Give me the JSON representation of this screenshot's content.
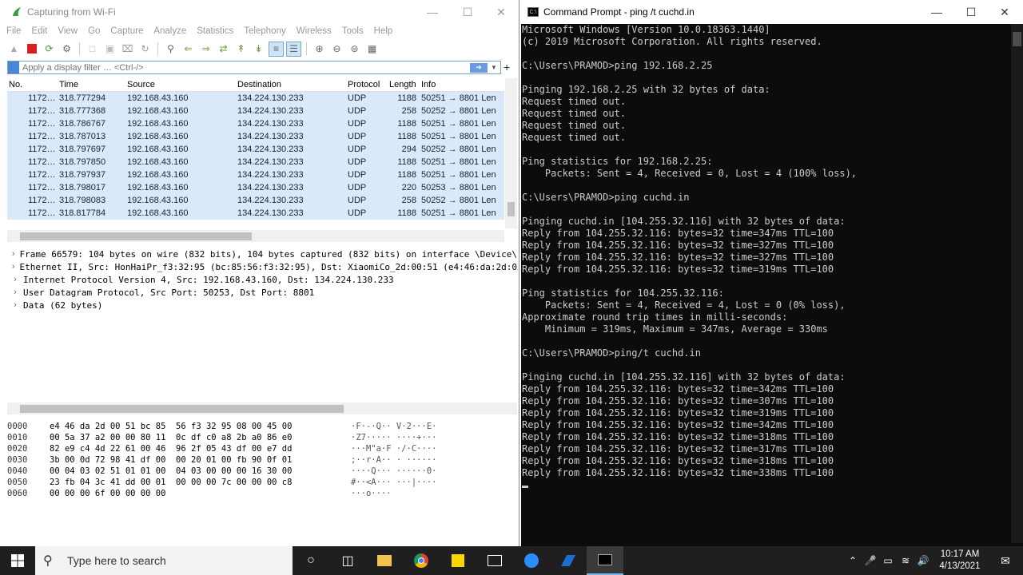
{
  "wireshark": {
    "title": "Capturing from Wi-Fi",
    "menu": [
      "File",
      "Edit",
      "View",
      "Go",
      "Capture",
      "Analyze",
      "Statistics",
      "Telephony",
      "Wireless",
      "Tools",
      "Help"
    ],
    "filter_placeholder": "Apply a display filter … <Ctrl-/>",
    "columns": [
      "No.",
      "Time",
      "Source",
      "Destination",
      "Protocol",
      "Length",
      "Info"
    ],
    "packets": [
      {
        "no": "1172…",
        "time": "318.777294",
        "src": "192.168.43.160",
        "dst": "134.224.130.233",
        "proto": "UDP",
        "len": "1188",
        "info": "50251 → 8801 Len"
      },
      {
        "no": "1172…",
        "time": "318.777368",
        "src": "192.168.43.160",
        "dst": "134.224.130.233",
        "proto": "UDP",
        "len": "258",
        "info": "50252 → 8801 Len"
      },
      {
        "no": "1172…",
        "time": "318.786767",
        "src": "192.168.43.160",
        "dst": "134.224.130.233",
        "proto": "UDP",
        "len": "1188",
        "info": "50251 → 8801 Len"
      },
      {
        "no": "1172…",
        "time": "318.787013",
        "src": "192.168.43.160",
        "dst": "134.224.130.233",
        "proto": "UDP",
        "len": "1188",
        "info": "50251 → 8801 Len"
      },
      {
        "no": "1172…",
        "time": "318.797697",
        "src": "192.168.43.160",
        "dst": "134.224.130.233",
        "proto": "UDP",
        "len": "294",
        "info": "50252 → 8801 Len"
      },
      {
        "no": "1172…",
        "time": "318.797850",
        "src": "192.168.43.160",
        "dst": "134.224.130.233",
        "proto": "UDP",
        "len": "1188",
        "info": "50251 → 8801 Len"
      },
      {
        "no": "1172…",
        "time": "318.797937",
        "src": "192.168.43.160",
        "dst": "134.224.130.233",
        "proto": "UDP",
        "len": "1188",
        "info": "50251 → 8801 Len"
      },
      {
        "no": "1172…",
        "time": "318.798017",
        "src": "192.168.43.160",
        "dst": "134.224.130.233",
        "proto": "UDP",
        "len": "220",
        "info": "50253 → 8801 Len"
      },
      {
        "no": "1172…",
        "time": "318.798083",
        "src": "192.168.43.160",
        "dst": "134.224.130.233",
        "proto": "UDP",
        "len": "258",
        "info": "50252 → 8801 Len"
      },
      {
        "no": "1172…",
        "time": "318.817784",
        "src": "192.168.43.160",
        "dst": "134.224.130.233",
        "proto": "UDP",
        "len": "1188",
        "info": "50251 → 8801 Len"
      }
    ],
    "details": [
      "Frame 66579: 104 bytes on wire (832 bits), 104 bytes captured (832 bits) on interface \\Device\\",
      "Ethernet II, Src: HonHaiPr_f3:32:95 (bc:85:56:f3:32:95), Dst: XiaomiCo_2d:00:51 (e4:46:da:2d:0",
      "Internet Protocol Version 4, Src: 192.168.43.160, Dst: 134.224.130.233",
      "User Datagram Protocol, Src Port: 50253, Dst Port: 8801",
      "Data (62 bytes)"
    ],
    "hex": [
      {
        "off": "0000",
        "bytes": "e4 46 da 2d 00 51 bc 85  56 f3 32 95 08 00 45 00",
        "ascii": "·F·-·Q·· V·2···E·"
      },
      {
        "off": "0010",
        "bytes": "00 5a 37 a2 00 00 80 11  0c df c0 a8 2b a0 86 e0",
        "ascii": "·Z7····· ····+···"
      },
      {
        "off": "0020",
        "bytes": "82 e9 c4 4d 22 61 00 46  96 2f 05 43 df 00 e7 dd",
        "ascii": "···M\"a·F ·/·C····"
      },
      {
        "off": "0030",
        "bytes": "3b 00 0d 72 98 41 df 00  00 20 01 00 fb 90 0f 01",
        "ascii": ";··r·A·· · ······"
      },
      {
        "off": "0040",
        "bytes": "00 04 03 02 51 01 01 00  04 03 00 00 00 16 30 00",
        "ascii": "····Q··· ······0·"
      },
      {
        "off": "0050",
        "bytes": "23 fb 04 3c 41 dd 00 01  00 00 00 7c 00 00 00 c8",
        "ascii": "#··<A··· ···|····"
      },
      {
        "off": "0060",
        "bytes": "00 00 00 6f 00 00 00 00",
        "ascii": "···o····"
      }
    ]
  },
  "cmd": {
    "title": "Command Prompt - ping /t cuchd.in",
    "lines": [
      "Microsoft Windows [Version 10.0.18363.1440]",
      "(c) 2019 Microsoft Corporation. All rights reserved.",
      "",
      "C:\\Users\\PRAMOD>ping 192.168.2.25",
      "",
      "Pinging 192.168.2.25 with 32 bytes of data:",
      "Request timed out.",
      "Request timed out.",
      "Request timed out.",
      "Request timed out.",
      "",
      "Ping statistics for 192.168.2.25:",
      "    Packets: Sent = 4, Received = 0, Lost = 4 (100% loss),",
      "",
      "C:\\Users\\PRAMOD>ping cuchd.in",
      "",
      "Pinging cuchd.in [104.255.32.116] with 32 bytes of data:",
      "Reply from 104.255.32.116: bytes=32 time=347ms TTL=100",
      "Reply from 104.255.32.116: bytes=32 time=327ms TTL=100",
      "Reply from 104.255.32.116: bytes=32 time=327ms TTL=100",
      "Reply from 104.255.32.116: bytes=32 time=319ms TTL=100",
      "",
      "Ping statistics for 104.255.32.116:",
      "    Packets: Sent = 4, Received = 4, Lost = 0 (0% loss),",
      "Approximate round trip times in milli-seconds:",
      "    Minimum = 319ms, Maximum = 347ms, Average = 330ms",
      "",
      "C:\\Users\\PRAMOD>ping/t cuchd.in",
      "",
      "Pinging cuchd.in [104.255.32.116] with 32 bytes of data:",
      "Reply from 104.255.32.116: bytes=32 time=342ms TTL=100",
      "Reply from 104.255.32.116: bytes=32 time=307ms TTL=100",
      "Reply from 104.255.32.116: bytes=32 time=319ms TTL=100",
      "Reply from 104.255.32.116: bytes=32 time=342ms TTL=100",
      "Reply from 104.255.32.116: bytes=32 time=318ms TTL=100",
      "Reply from 104.255.32.116: bytes=32 time=317ms TTL=100",
      "Reply from 104.255.32.116: bytes=32 time=318ms TTL=100",
      "Reply from 104.255.32.116: bytes=32 time=338ms TTL=100"
    ]
  },
  "taskbar": {
    "search_placeholder": "Type here to search",
    "time": "10:17 AM",
    "date": "4/13/2021"
  }
}
